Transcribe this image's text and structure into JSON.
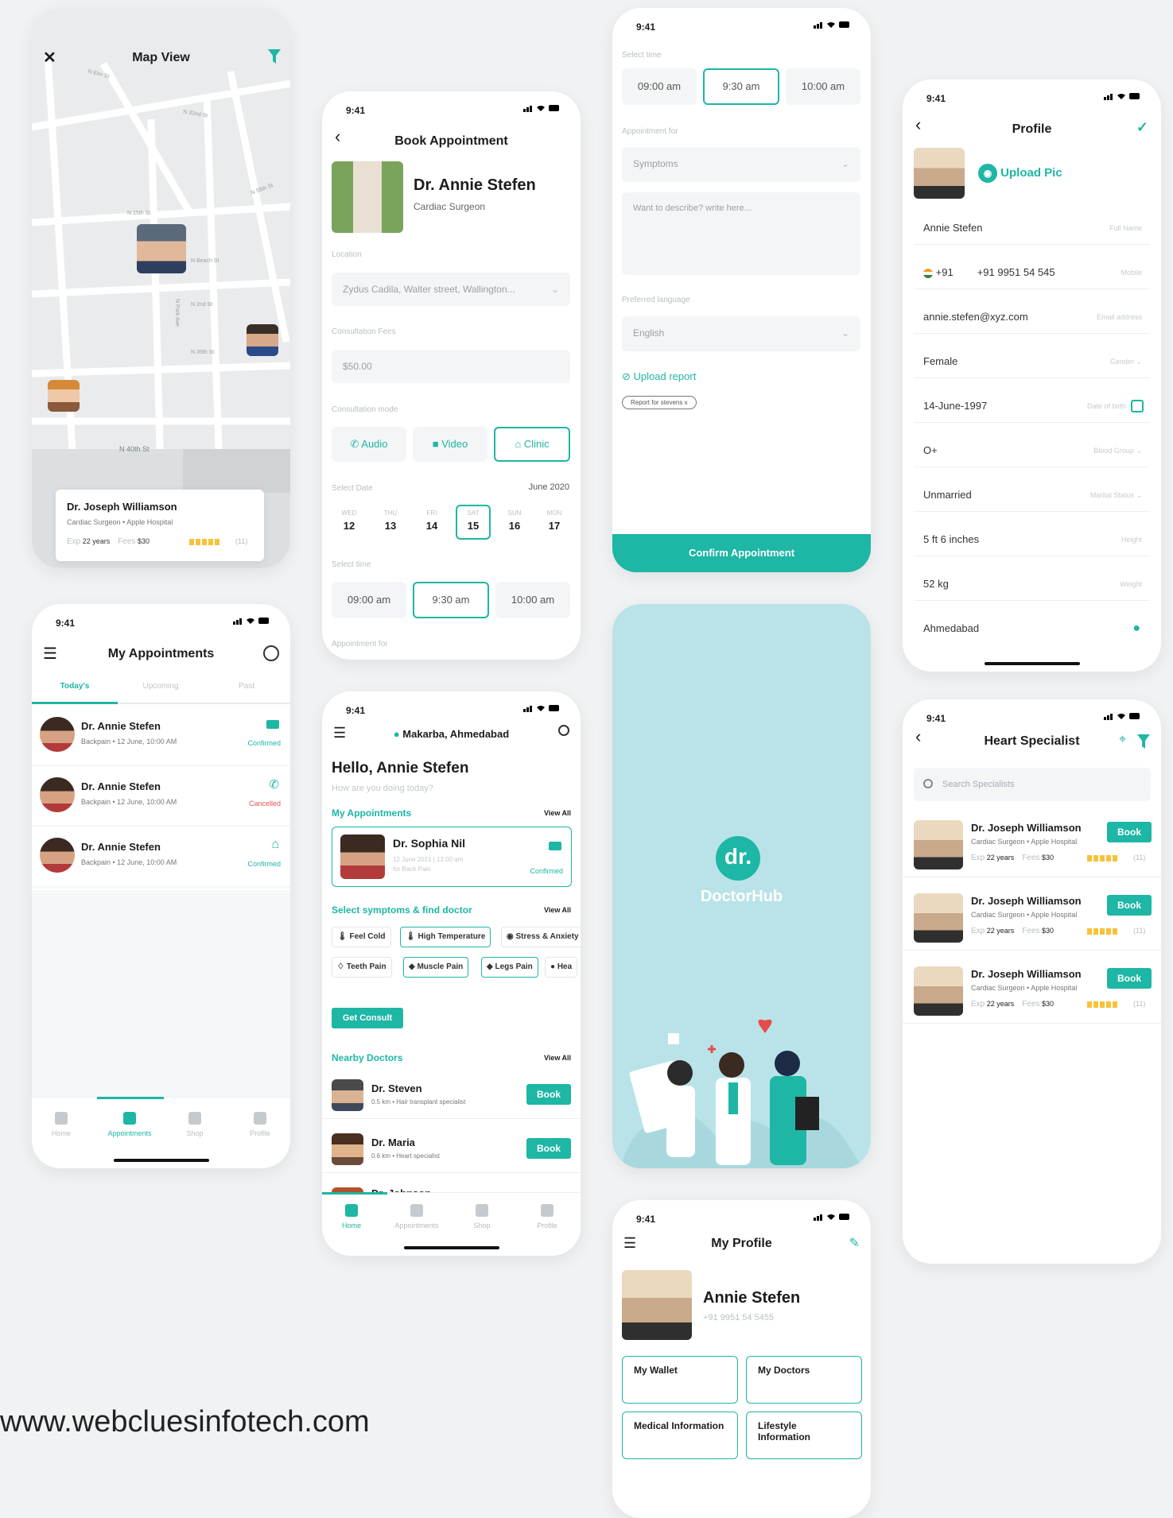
{
  "status": {
    "time": "9:41"
  },
  "map": {
    "title": "Map View",
    "streets": [
      "N Elm St",
      "N 32nd St",
      "N 15th St",
      "N Beach St",
      "N 2nd St",
      "N Park Ave",
      "N 55th St",
      "N 35th St",
      "N 40th St"
    ],
    "card": {
      "name": "Dr. Joseph Williamson",
      "sub": "Cardiac Surgeon • Apple Hospital",
      "exp_label": "Exp",
      "exp": "22 years",
      "fees_label": "Fees",
      "fees": "$30",
      "rating": "(11)"
    }
  },
  "book": {
    "title": "Book Appointment",
    "doctor": "Dr. Annie Stefen",
    "speciality": "Cardiac Surgeon",
    "location_label": "Location",
    "location": "Zydus Cadila, Walter street, Wallington...",
    "fees_label": "Consultation Fees",
    "fees": "$50.00",
    "mode_label": "Consultation mode",
    "modes": [
      "Audio",
      "Video",
      "Clinic"
    ],
    "date_label": "Select Date",
    "month": "June 2020",
    "days": [
      {
        "d": "WED",
        "n": "12"
      },
      {
        "d": "THU",
        "n": "13"
      },
      {
        "d": "FRI",
        "n": "14"
      },
      {
        "d": "SAT",
        "n": "15"
      },
      {
        "d": "SUN",
        "n": "16"
      },
      {
        "d": "MON",
        "n": "17"
      }
    ],
    "time_label": "Select time",
    "times": [
      "09:00 am",
      "9:30 am",
      "10:00 am"
    ],
    "appt_label": "Appointment for"
  },
  "confirm": {
    "time_label": "Select time",
    "times": [
      "09:00 am",
      "9:30 am",
      "10:00 am"
    ],
    "appt_label": "Appointment for",
    "symptoms_placeholder": "Symptoms",
    "describe_placeholder": "Want to describe? write here...",
    "lang_label": "Preferred language",
    "lang": "English",
    "upload": "Upload report",
    "report_tag": "Report for stevens x",
    "button": "Confirm Appointment"
  },
  "profile": {
    "title": "Profile",
    "upload_pic": "Upload Pic",
    "fields": [
      {
        "value": "Annie Stefen",
        "hint": "Full Name"
      },
      {
        "value": "+91 9951 54 545",
        "hint": "Mobile",
        "code": "+91"
      },
      {
        "value": "annie.stefen@xyz.com",
        "hint": "Email address"
      },
      {
        "value": "Female",
        "hint": "Gender"
      },
      {
        "value": "14-June-1997",
        "hint": "Date of birth"
      },
      {
        "value": "O+",
        "hint": "Blood Group"
      },
      {
        "value": "Unmarried",
        "hint": "Marital Status"
      },
      {
        "value": "5 ft 6 inches",
        "hint": "Height"
      },
      {
        "value": "52 kg",
        "hint": "Weight"
      },
      {
        "value": "Ahmedabad",
        "hint": ""
      }
    ]
  },
  "appointments": {
    "title": "My Appointments",
    "tabs": [
      "Today's",
      "Upcoming",
      "Past"
    ],
    "items": [
      {
        "name": "Dr. Annie Stefen",
        "sub": "Backpain • 12 June, 10:00 AM",
        "status": "Confirmed",
        "status_color": "#1eb6a4",
        "icon": "video-icon"
      },
      {
        "name": "Dr. Annie Stefen",
        "sub": "Backpain • 12 June, 10:00 AM",
        "status": "Cancelled",
        "status_color": "#e25555",
        "icon": "phone-icon"
      },
      {
        "name": "Dr. Annie Stefen",
        "sub": "Backpain • 12 June, 10:00 AM",
        "status": "Confirmed",
        "status_color": "#1eb6a4",
        "icon": "clinic-icon"
      }
    ],
    "nav": [
      "Home",
      "Appointments",
      "Shop",
      "Profile"
    ]
  },
  "home": {
    "location": "Makarba, Ahmedabad",
    "greeting": "Hello, Annie Stefen",
    "sub": "How are you doing today?",
    "appt_title": "My Appointments",
    "view_all": "View All",
    "appt": {
      "name": "Dr. Sophia Nil",
      "line1": "12 June 2021 | 12:00 am",
      "line2": "for Back Pain",
      "status": "Confirmed"
    },
    "symptoms_title": "Select symptoms & find doctor",
    "symptoms": [
      "Feel Cold",
      "High Temperature",
      "Stress & Anxiety",
      "Teeth Pain",
      "Muscle Pain",
      "Legs Pain",
      "Hea"
    ],
    "consult": "Get Consult",
    "nearby_title": "Nearby Doctors",
    "nearby": [
      {
        "name": "Dr. Steven",
        "sub": "0.5 km • Hair transplant specialist"
      },
      {
        "name": "Dr. Maria",
        "sub": "0.6 km • Heart specialist"
      },
      {
        "name": "Dr. Johnson",
        "sub": ""
      }
    ],
    "book": "Book",
    "nav": [
      "Home",
      "Appointments",
      "Shop",
      "Profile"
    ]
  },
  "splash": {
    "logo": "dr.",
    "brand": "DoctorHub"
  },
  "heart": {
    "title": "Heart Specialist",
    "search_placeholder": "Search Specialists",
    "doctors": [
      {
        "name": "Dr. Joseph Williamson",
        "sub": "Cardiac Surgeon • Apple Hospital",
        "exp_label": "Exp",
        "exp": "22 years",
        "fees_label": "Fees",
        "fees": "$30",
        "rating": "(11)"
      },
      {
        "name": "Dr. Joseph Williamson",
        "sub": "Cardiac Surgeon • Apple Hospital",
        "exp_label": "Exp",
        "exp": "22 years",
        "fees_label": "Fees",
        "fees": "$30",
        "rating": "(11)"
      },
      {
        "name": "Dr. Joseph Williamson",
        "sub": "Cardiac Surgeon • Apple Hospital",
        "exp_label": "Exp",
        "exp": "22 years",
        "fees_label": "Fees",
        "fees": "$30",
        "rating": "(11)"
      }
    ],
    "book": "Book"
  },
  "myprofile": {
    "title": "My Profile",
    "name": "Annie Stefen",
    "phone": "+91 9951 54 5455",
    "tiles": [
      "My Wallet",
      "My Doctors",
      "Medical Information",
      "Lifestyle Information"
    ]
  },
  "footer": {
    "url": "www.webcluesinfotech.com"
  },
  "colors": {
    "accent": "#1eb6a4",
    "splash_bg": "#b9e3e8",
    "cancel": "#e25555",
    "star": "#f6c23a"
  }
}
